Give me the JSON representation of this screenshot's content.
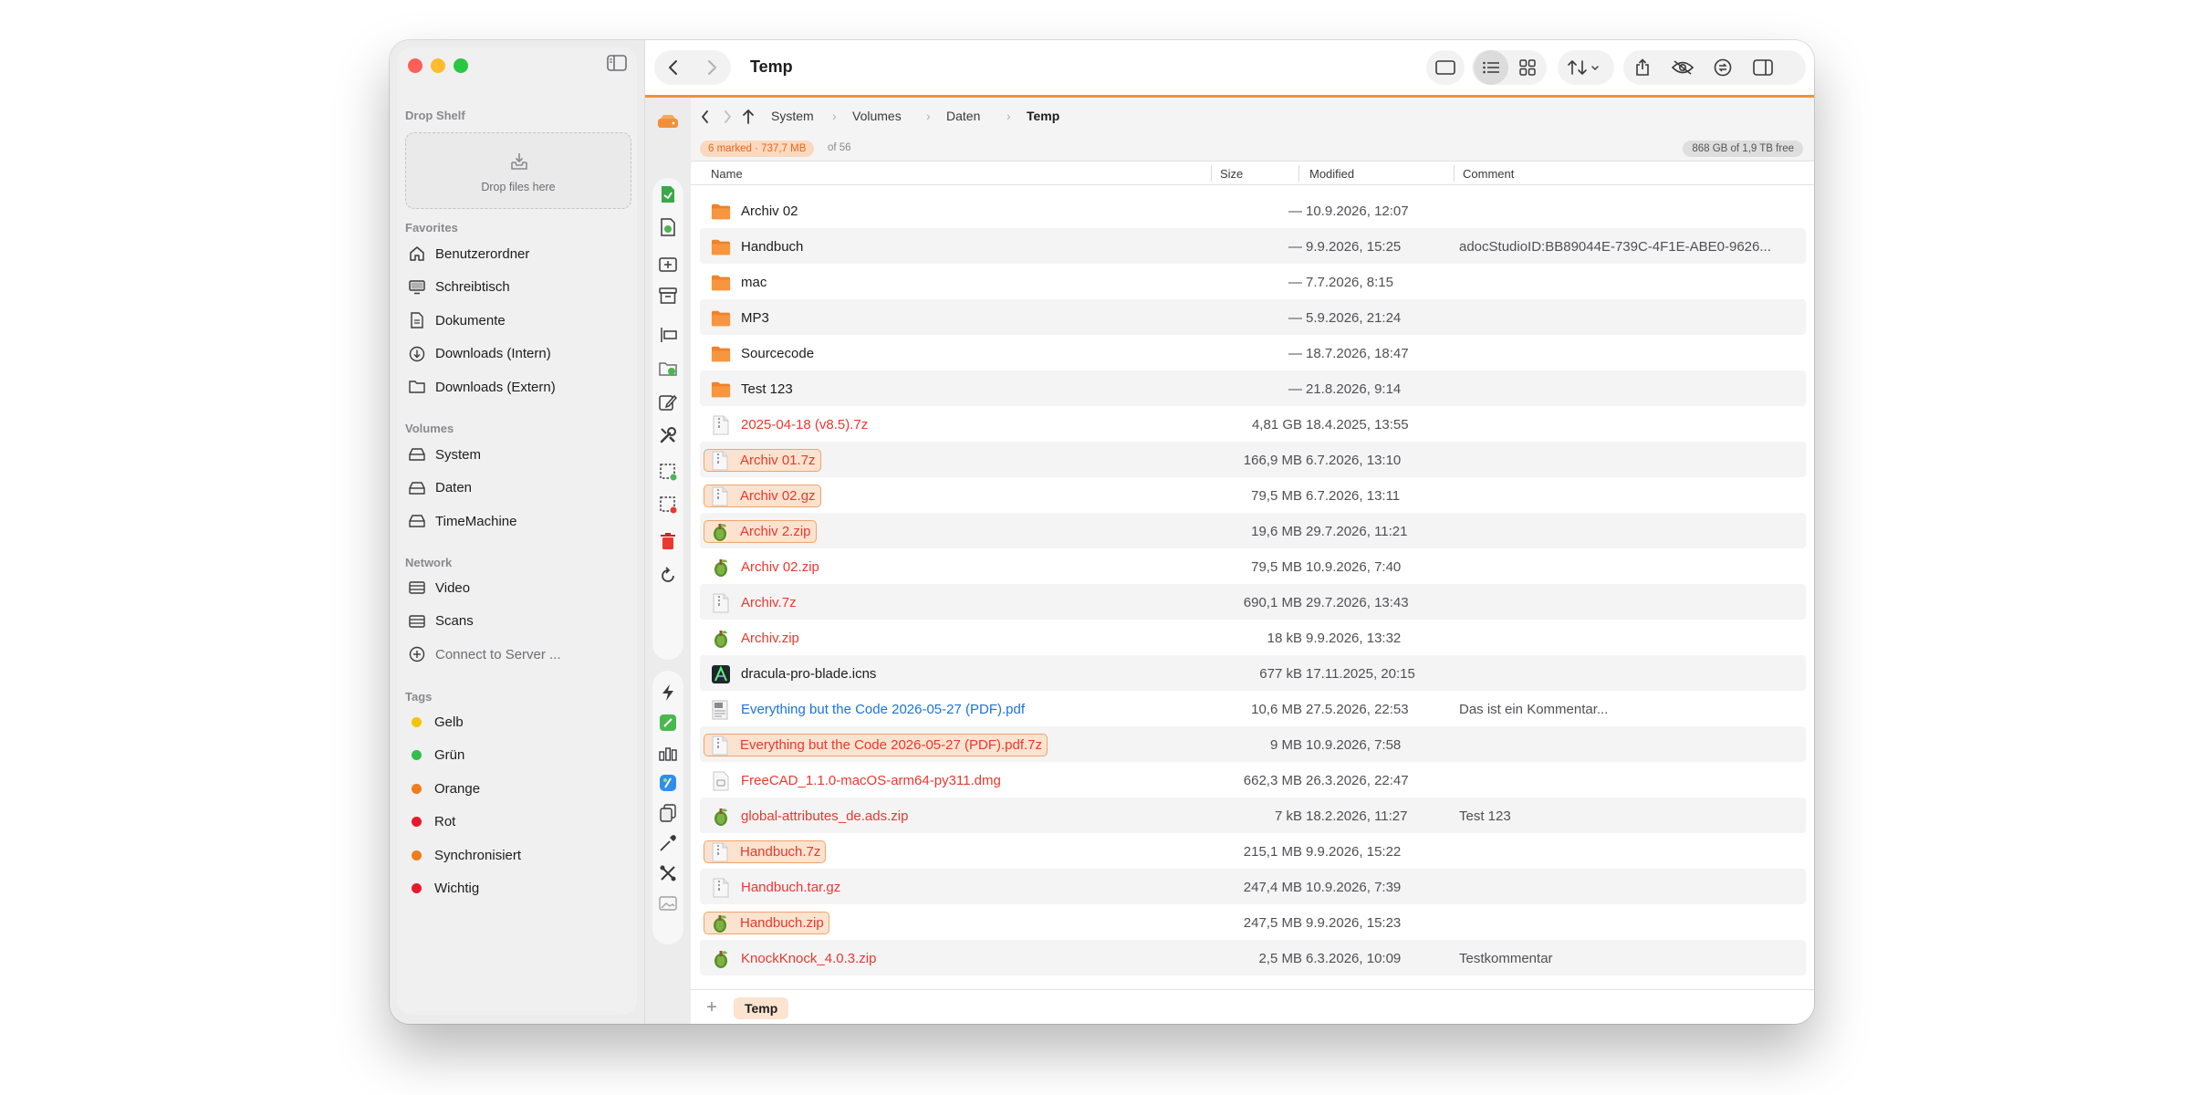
{
  "window": {
    "title": "Temp"
  },
  "sidebar": {
    "drop_shelf": {
      "title": "Drop Shelf",
      "hint": "Drop files here"
    },
    "favorites": {
      "title": "Favorites",
      "items": [
        {
          "label": "Benutzerordner",
          "icon": "home-icon"
        },
        {
          "label": "Schreibtisch",
          "icon": "desktop-icon"
        },
        {
          "label": "Dokumente",
          "icon": "document-icon"
        },
        {
          "label": "Downloads (Intern)",
          "icon": "download-icon"
        },
        {
          "label": "Downloads (Extern)",
          "icon": "folder-icon"
        }
      ]
    },
    "volumes": {
      "title": "Volumes",
      "items": [
        {
          "label": "System",
          "icon": "drive-icon"
        },
        {
          "label": "Daten",
          "icon": "drive-icon"
        },
        {
          "label": "TimeMachine",
          "icon": "drive-icon"
        }
      ]
    },
    "network": {
      "title": "Network",
      "items": [
        {
          "label": "Video",
          "icon": "server-icon"
        },
        {
          "label": "Scans",
          "icon": "server-icon"
        },
        {
          "label": "Connect to Server ...",
          "icon": "plus-circle-icon"
        }
      ]
    },
    "tags": {
      "title": "Tags",
      "items": [
        {
          "label": "Gelb",
          "color": "#f5c400"
        },
        {
          "label": "Grün",
          "color": "#2fbf4a"
        },
        {
          "label": "Orange",
          "color": "#f07c1a"
        },
        {
          "label": "Rot",
          "color": "#e8192c"
        },
        {
          "label": "Synchronisiert",
          "color": "#f07c1a"
        },
        {
          "label": "Wichtig",
          "color": "#e8192c"
        }
      ]
    }
  },
  "pathbar": {
    "crumbs": [
      "System",
      "Volumes",
      "Daten",
      "Temp"
    ]
  },
  "status": {
    "marked": "6 marked · 737,7 MB",
    "of_count": "of 56",
    "free": "868 GB of 1,9 TB free"
  },
  "columns": {
    "name": "Name",
    "size": "Size",
    "modified": "Modified",
    "comment": "Comment"
  },
  "files": [
    {
      "name": "Archiv 02",
      "size": "—",
      "modified": "10.9.2026, 12:07",
      "comment": "",
      "kind": "folder",
      "color": "black",
      "marked": false
    },
    {
      "name": "Handbuch",
      "size": "—",
      "modified": "9.9.2026, 15:25",
      "comment": "adocStudioID:BB89044E-739C-4F1E-ABE0-9626...",
      "kind": "folder",
      "color": "black",
      "marked": false
    },
    {
      "name": "mac",
      "size": "—",
      "modified": "7.7.2026, 8:15",
      "comment": "",
      "kind": "folder",
      "color": "black",
      "marked": false
    },
    {
      "name": "MP3",
      "size": "—",
      "modified": "5.9.2026, 21:24",
      "comment": "",
      "kind": "folder",
      "color": "black",
      "marked": false
    },
    {
      "name": "Sourcecode",
      "size": "—",
      "modified": "18.7.2026, 18:47",
      "comment": "",
      "kind": "folder",
      "color": "black",
      "marked": false
    },
    {
      "name": "Test 123",
      "size": "—",
      "modified": "21.8.2026, 9:14",
      "comment": "",
      "kind": "folder",
      "color": "black",
      "marked": false
    },
    {
      "name": "2025-04-18 (v8.5).7z",
      "size": "4,81 GB",
      "modified": "18.4.2025, 13:55",
      "comment": "",
      "kind": "archive",
      "color": "red",
      "marked": false
    },
    {
      "name": "Archiv 01.7z",
      "size": "166,9 MB",
      "modified": "6.7.2026, 13:10",
      "comment": "",
      "kind": "archive",
      "color": "red",
      "marked": true
    },
    {
      "name": "Archiv 02.gz",
      "size": "79,5 MB",
      "modified": "6.7.2026, 13:11",
      "comment": "",
      "kind": "archive",
      "color": "red",
      "marked": true
    },
    {
      "name": "Archiv 2.zip",
      "size": "19,6 MB",
      "modified": "29.7.2026, 11:21",
      "comment": "",
      "kind": "zip",
      "color": "red",
      "marked": true
    },
    {
      "name": "Archiv 02.zip",
      "size": "79,5 MB",
      "modified": "10.9.2026, 7:40",
      "comment": "",
      "kind": "zip",
      "color": "red",
      "marked": false
    },
    {
      "name": "Archiv.7z",
      "size": "690,1 MB",
      "modified": "29.7.2026, 13:43",
      "comment": "",
      "kind": "archive",
      "color": "red",
      "marked": false
    },
    {
      "name": "Archiv.zip",
      "size": "18 kB",
      "modified": "9.9.2026, 13:32",
      "comment": "",
      "kind": "zip",
      "color": "red",
      "marked": false
    },
    {
      "name": "dracula-pro-blade.icns",
      "size": "677 kB",
      "modified": "17.11.2025, 20:15",
      "comment": "",
      "kind": "icns",
      "color": "black",
      "marked": false
    },
    {
      "name": "Everything but the Code 2026-05-27 (PDF).pdf",
      "size": "10,6 MB",
      "modified": "27.5.2026, 22:53",
      "comment": "Das ist ein Kommentar...",
      "kind": "pdf",
      "color": "blue",
      "marked": false
    },
    {
      "name": "Everything but the Code 2026-05-27 (PDF).pdf.7z",
      "size": "9 MB",
      "modified": "10.9.2026, 7:58",
      "comment": "",
      "kind": "archive",
      "color": "red",
      "marked": true
    },
    {
      "name": "FreeCAD_1.1.0-macOS-arm64-py311.dmg",
      "size": "662,3 MB",
      "modified": "26.3.2026, 22:47",
      "comment": "",
      "kind": "dmg",
      "color": "red",
      "marked": false
    },
    {
      "name": "global-attributes_de.ads.zip",
      "size": "7 kB",
      "modified": "18.2.2026, 11:27",
      "comment": "Test 123",
      "kind": "zip",
      "color": "red",
      "marked": false
    },
    {
      "name": "Handbuch.7z",
      "size": "215,1 MB",
      "modified": "9.9.2026, 15:22",
      "comment": "",
      "kind": "archive",
      "color": "red",
      "marked": true
    },
    {
      "name": "Handbuch.tar.gz",
      "size": "247,4 MB",
      "modified": "10.9.2026, 7:39",
      "comment": "",
      "kind": "archive",
      "color": "red",
      "marked": false
    },
    {
      "name": "Handbuch.zip",
      "size": "247,5 MB",
      "modified": "9.9.2026, 15:23",
      "comment": "",
      "kind": "zip",
      "color": "red",
      "marked": true
    },
    {
      "name": "KnockKnock_4.0.3.zip",
      "size": "2,5 MB",
      "modified": "6.3.2026, 10:09",
      "comment": "Testkommentar",
      "kind": "zip",
      "color": "red",
      "marked": false
    }
  ],
  "bottom_tab": {
    "label": "Temp"
  },
  "colors": {
    "accent": "#f0913a",
    "marked_bg": "#fce3cf",
    "red_text": "#e8392f",
    "blue_text": "#1a73d9"
  }
}
